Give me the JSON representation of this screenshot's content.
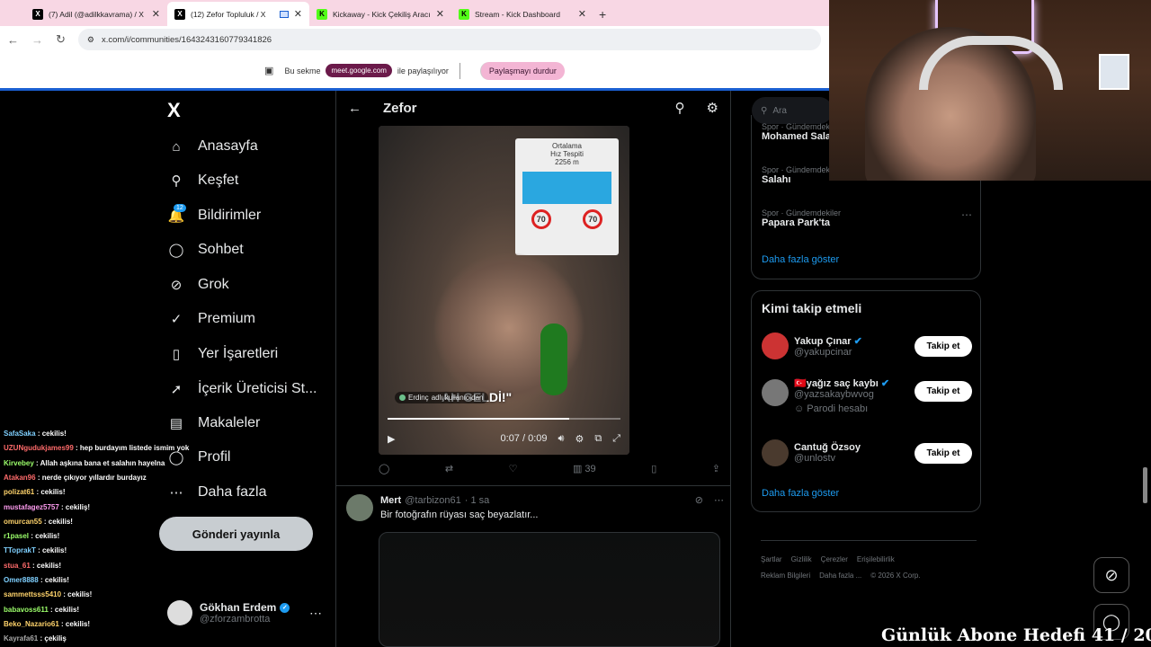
{
  "browser": {
    "tabs": [
      {
        "title": "(7) Adil (@adilkkavrama) / X",
        "icon": "x-logo-icon",
        "color": "#000000",
        "active": false
      },
      {
        "title": "(12) Zefor Topluluk / X",
        "icon": "x-logo-icon",
        "color": "#000000",
        "active": true
      },
      {
        "title": "Kickaway - Kick Çekiliş Aracı",
        "icon": "kick-icon",
        "color": "#53fc18",
        "active": false
      },
      {
        "title": "Stream - Kick Dashboard",
        "icon": "kick-icon",
        "color": "#53fc18",
        "active": false
      }
    ],
    "url": "x.com/i/communities/1643243160779341826",
    "share_notice": "Bu sekme",
    "share_target": "meet.google.com",
    "share_suffix": "ile paylaşılıyor",
    "stop_share": "Paylaşmayı durdur"
  },
  "nav": {
    "logo": "X",
    "items": [
      {
        "label": "Anasayfa",
        "icon": "home-icon",
        "glyph": "⌂"
      },
      {
        "label": "Keşfet",
        "icon": "search-icon",
        "glyph": "⚲"
      },
      {
        "label": "Bildirimler",
        "icon": "bell-icon",
        "glyph": "🔔"
      },
      {
        "label": "Sohbet",
        "icon": "chat-bubble-icon",
        "glyph": "◯"
      },
      {
        "label": "Grok",
        "icon": "grok-icon",
        "glyph": "⊘"
      },
      {
        "label": "Premium",
        "icon": "verified-badge-icon",
        "glyph": "✓"
      },
      {
        "label": "Yer İşaretleri",
        "icon": "bookmark-icon",
        "glyph": "▯"
      },
      {
        "label": "İçerik Üreticisi St...",
        "icon": "rocket-icon",
        "glyph": "➚"
      },
      {
        "label": "Makaleler",
        "icon": "article-icon",
        "glyph": "▤"
      },
      {
        "label": "Profil",
        "icon": "person-icon",
        "glyph": "◯"
      },
      {
        "label": "Daha fazla",
        "icon": "more-circle-icon",
        "glyph": "⋯"
      }
    ],
    "notif_count": "12",
    "post_button": "Gönderi yayınla",
    "profile": {
      "name": "Gökhan Erdem",
      "handle": "@zforzambrotta"
    }
  },
  "feed": {
    "title": "Zefor",
    "video": {
      "sign_line1": "Ortalama",
      "sign_line2": "Hız Tespiti",
      "sign_line3": "2256 m",
      "speed1": "70",
      "speed2": "70",
      "caption": "AH GELDİ!\"",
      "shared_by": "Erdinç",
      "shared_suffix": "adlı kullanıcıdan",
      "time": "0:07 / 0:09",
      "progress": 0.78
    },
    "actions": {
      "views": "39"
    },
    "next_post": {
      "name": "Mert",
      "handle": "@tarbizon61",
      "time": "· 1 sa",
      "text": "Bir fotoğrafın rüyası saç beyazlatır..."
    }
  },
  "right": {
    "search_placeholder": "Ara",
    "trends": [
      {
        "category": "Spor · Gündemdekiler",
        "name": "Mohamed Salah"
      },
      {
        "category": "Spor · Gündemdekiler",
        "name": "Salahı"
      },
      {
        "category": "Spor · Gündemdekiler",
        "name": "Papara Park'ta"
      }
    ],
    "show_more": "Daha fazla göster",
    "who_to_follow_title": "Kimi takip etmeli",
    "suggestions": [
      {
        "name": "Yakup Çınar",
        "handle": "@yakupcinar",
        "note": ""
      },
      {
        "name": "🇹🇷yağız saç kaybı",
        "handle": "@yazsakaybwvog",
        "note": "Parodi hesabı"
      },
      {
        "name": "Cantuğ Özsoy",
        "handle": "@unlostv",
        "note": ""
      }
    ],
    "follow_label": "Takip et",
    "footer": {
      "line1": [
        "Şartlar",
        "Gizlilik",
        "Çerezler",
        "Erişilebilirlik"
      ],
      "line2": [
        "Reklam Bilgileri",
        "Daha fazla ...",
        "© 2026 X Corp."
      ]
    }
  },
  "chat": [
    {
      "user": "SafaSaka",
      "color": "#7fd0ff",
      "msg": ": cekilis!"
    },
    {
      "user": "UZUNgudukjames99",
      "color": "#ff6b6b",
      "msg": ": hep burdayım listede ismim yok"
    },
    {
      "user": "Kirvebey",
      "color": "#9cff6b",
      "msg": ": Allah aşkına bana et salahın hayelna"
    },
    {
      "user": "Atakan96",
      "color": "#ff6b6b",
      "msg": ": nerde çıkıyor yıllardır burdayız"
    },
    {
      "user": "polizat61",
      "color": "#ffd36b",
      "msg": ": cekilis!"
    },
    {
      "user": "mustafagez5757",
      "color": "#ff9cf0",
      "msg": ": cekiliş!"
    },
    {
      "user": "omurcan55",
      "color": "#ffd36b",
      "msg": ": cekilis!"
    },
    {
      "user": "r1pasel",
      "color": "#9cff6b",
      "msg": ": cekilis!"
    },
    {
      "user": "TToprakT",
      "color": "#7fd0ff",
      "msg": ": cekilis!"
    },
    {
      "user": "stua_61",
      "color": "#ff6b6b",
      "msg": ": cekilis!"
    },
    {
      "user": "Omer8888",
      "color": "#7fd0ff",
      "msg": ": cekilis!"
    },
    {
      "user": "sammettsss5410",
      "color": "#ffd36b",
      "msg": ": cekilis!"
    },
    {
      "user": "babavoss611",
      "color": "#9cff6b",
      "msg": ": cekilis!"
    },
    {
      "user": "Beko_Nazario61",
      "color": "#ffd36b",
      "msg": ": cekilis!"
    },
    {
      "user": "Kayrafa61",
      "color": "#aaaaaa",
      "msg": ": çekiliş"
    }
  ],
  "overlay": {
    "goal_text": "Günlük Abone Hedefi 41 / 20"
  }
}
